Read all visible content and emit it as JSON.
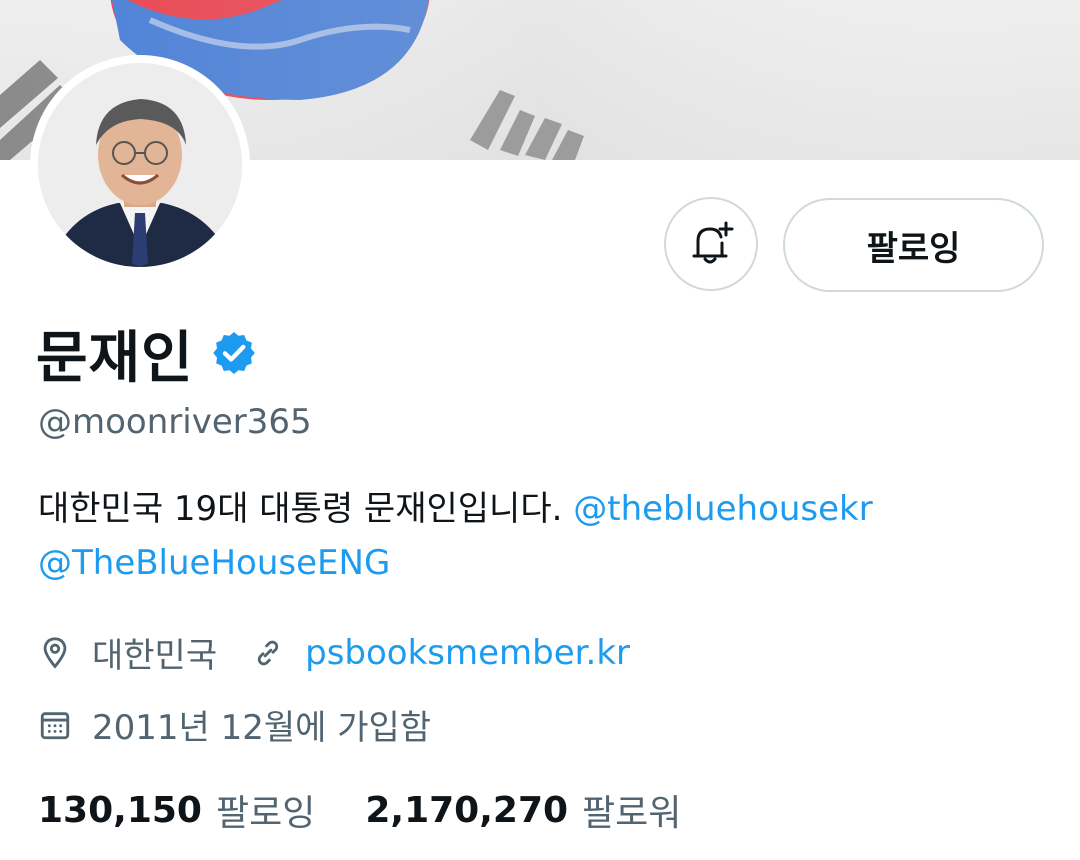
{
  "profile": {
    "name": "문재인",
    "handle": "@moonriver365",
    "bio_text": "대한민국 19대 대통령 문재인입니다.",
    "bio_mention_1": "@thebluehousekr",
    "bio_mention_2": "@TheBlueHouseENG",
    "location": "대한민국",
    "website": "psbooksmember.kr",
    "joined": "2011년 12월에 가입함"
  },
  "actions": {
    "follow_label": "팔로잉",
    "notify_icon": "bell-plus-icon"
  },
  "stats": {
    "following_count": "130,150",
    "following_label": "팔로잉",
    "followers_count": "2,170,270",
    "followers_label": "팔로워"
  },
  "colors": {
    "link": "#1d9bf0",
    "secondary_text": "#536471",
    "verified_badge": "#1d9bf0",
    "flag_red": "#e8444f",
    "flag_blue": "#4a7fd6"
  }
}
